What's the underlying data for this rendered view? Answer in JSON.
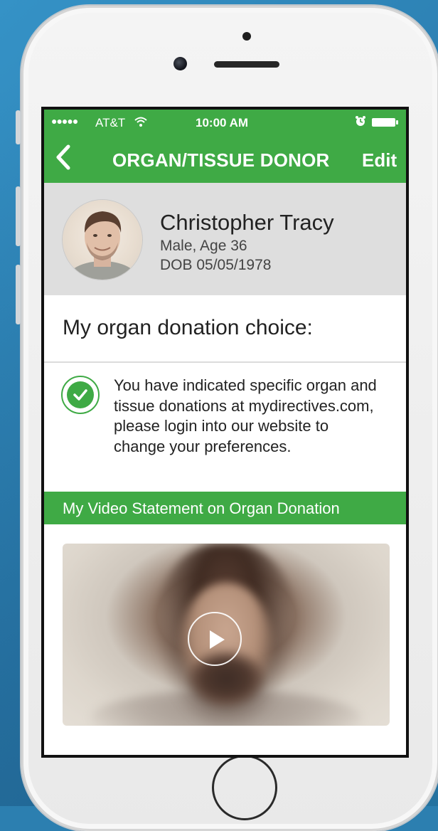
{
  "status_bar": {
    "signal": "●●●●●",
    "carrier": "AT&T",
    "time": "10:00 AM"
  },
  "nav": {
    "back_icon": "chevron-left-icon",
    "title": "ORGAN/TISSUE DONOR",
    "edit_label": "Edit"
  },
  "profile": {
    "name": "Christopher Tracy",
    "gender_age": "Male, Age 36",
    "dob": "DOB 05/05/1978"
  },
  "donation": {
    "heading": "My organ donation choice:",
    "status_icon": "check-circle-icon",
    "message": "You have indicated specific organ and tissue donations at mydirectives.com, please login into our website to change your preferences."
  },
  "video": {
    "header": "My Video Statement on Organ Donation",
    "play_icon": "play-icon"
  },
  "colors": {
    "accent": "#3faa45",
    "profile_bg": "#dedede",
    "background": "#2c7fb0"
  }
}
